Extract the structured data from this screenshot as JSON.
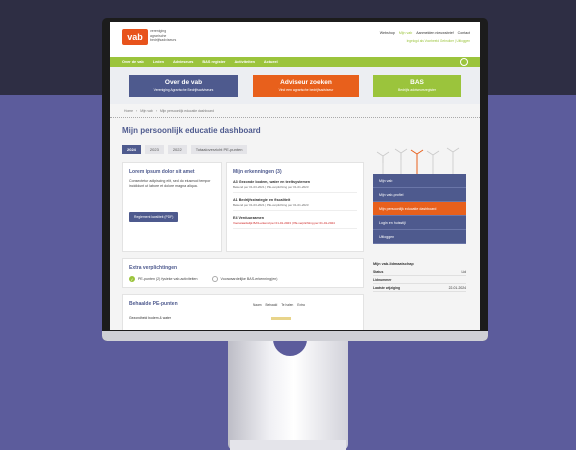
{
  "header": {
    "logo": "vab",
    "logo_sub": [
      "vereniging",
      "agrarische",
      "bedrijfsadviseurs"
    ],
    "top_links": [
      "Webshop",
      "Mijn vab",
      "Aanmelden nieuwsbrief",
      "Contact"
    ],
    "login_line": "Ingelogd als Voorbeeld Gebruiker | Uitloggen"
  },
  "nav": {
    "items": [
      "Over de vab",
      "Leden",
      "Advieseurs",
      "BAS register",
      "Activiteiten",
      "Actueel"
    ]
  },
  "hero": {
    "buttons": [
      {
        "title": "Over de vab",
        "sub": "Vereniging Agrarische Bedrijfsadviseurs"
      },
      {
        "title": "Adviseur zoeken",
        "sub": "Vind een agrarische bedrijfsadviseur"
      },
      {
        "title": "BAS",
        "sub": "Bedrijfs adviseursregister"
      }
    ]
  },
  "breadcrumb": [
    "Home",
    "Mijn vab",
    "Mijn persoonlijk educatie dashboard"
  ],
  "page": {
    "title": "Mijn persoonlijk educatie dashboard",
    "tabs": [
      "2024",
      "2023",
      "2022",
      "Totaaloverzicht PE-punten"
    ]
  },
  "intro_card": {
    "title": "Lorem ipsum dolor sit amet",
    "text": "Consectetur adipiscing elit, sed do eiusmod tempor incididunt ut labore et dolore magna aliqua.",
    "button": "Reglement kwaliteit (PDF)"
  },
  "erkenningen": {
    "title": "Mijn erkenningen (3)",
    "items": [
      {
        "name": "A3 Gezonde bodem, water en teeltsystemen",
        "meta": "Bekend per 01-03-2021 | PE-verplichting per 01-01-2023"
      },
      {
        "name": "A1 Bedrijfsstrategie en fiscaliteit",
        "meta": "Bekend per 01-03-2021 | PE-verplichting per 01-01-2023"
      },
      {
        "name": "E4 Verduurzamen",
        "meta": "Voorwaardelijk BAS-erkend per 01-01-2023 | PE-verplichting per 01-01-2024"
      }
    ]
  },
  "extra": {
    "title": "Extra verplichtingen",
    "items": [
      "PE-punten (2) fysieke vab-activiteiten",
      "Voorwaardelijke BAS-erkenning(en)"
    ]
  },
  "behaalde": {
    "title": "Behaalde PE-punten",
    "columns": [
      "Naam",
      "Behaald",
      "Te halen",
      "Extra"
    ],
    "row": "Gezondheid bodem & water"
  },
  "sidebar": {
    "items": [
      "Mijn vab",
      "Mijn vab-profiel",
      "Mijn persoonlijk educatie dashboard",
      "Login en huisstijl",
      "Uitloggen"
    ],
    "active_index": 2,
    "membership": {
      "title": "Mijn vab-lidmaatschap",
      "rows": [
        {
          "label": "Status",
          "value": "Lid"
        },
        {
          "label": "Lidnummer",
          "value": ""
        },
        {
          "label": "Laatste wijziging",
          "value": "22-01-2024"
        }
      ]
    }
  },
  "colors": {
    "brand_blue": "#4e5a8e",
    "brand_orange": "#e8601c",
    "brand_green": "#9bc43c"
  }
}
